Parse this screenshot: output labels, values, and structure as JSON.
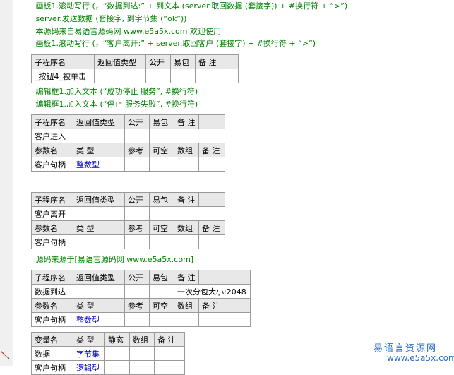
{
  "code_lines": [
    "' 画板1.滚动写行 (，“数据到达:” + 到文本 (server.取回数据 (套接字)) + #换行符 + “>”)",
    "' server.发送数据 (套接字, 到字节集 (“ok”))",
    "' 本源码来自易语言源码网 www.e5a5x.com  欢迎使用",
    "' 画板1.滚动写行 (，“客户离开:” + server.取回客户 (套接字) + #换行符 + “>”)",
    "' 编辑框1.加入文本 (“成功停止 服务”, #换行符)",
    "' 编辑框1.加入文本 (“停止 服务失败”, #换行符)",
    "' 源码来源于[易语言源码网 www.e5a5x.com]"
  ],
  "headers": {
    "sub": [
      "子程序名",
      "返回值类型",
      "公开",
      "易包",
      "备 注"
    ],
    "param": [
      "参数名",
      "类 型",
      "参考",
      "可空",
      "数组",
      "备 注"
    ],
    "var": [
      "变量名",
      "类 型",
      "静态",
      "数组",
      "备 注"
    ]
  },
  "t1": {
    "name": "_按钮4_被单击"
  },
  "t2": {
    "name": "客户进入",
    "param_name": "客户句柄",
    "param_type": "整数型"
  },
  "t3": {
    "name": "客户离开",
    "param_name": "客户句柄"
  },
  "t4": {
    "name": "数据到达",
    "remark": "一次分包大小:2048",
    "param_name": "客户句柄",
    "param_type": "整数型"
  },
  "t5": {
    "var_name": "数据",
    "var_type": "字节集",
    "row2_name": "客户句柄",
    "row2_type": "逻辑型"
  },
  "watermark": {
    "cn": "易语言资源网",
    "url": "www.e5a5x.com"
  }
}
